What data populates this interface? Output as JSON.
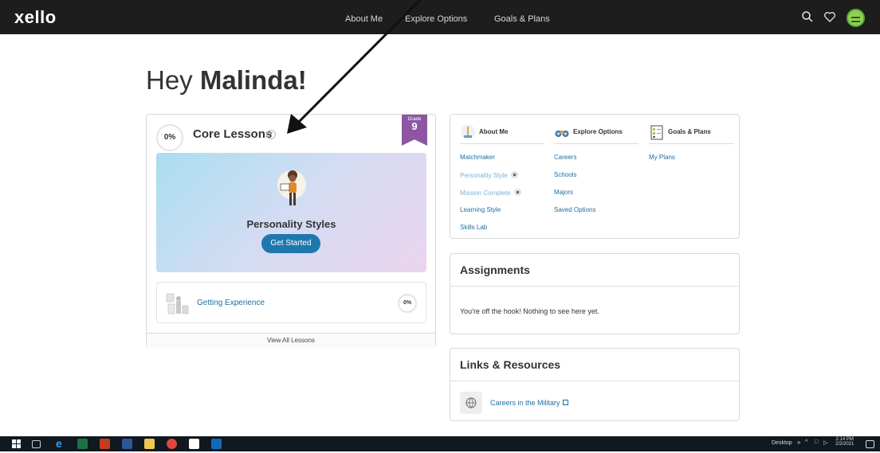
{
  "nav": {
    "logo": "xello",
    "items": [
      "About Me",
      "Explore Options",
      "Goals & Plans"
    ]
  },
  "greeting": {
    "hey": "Hey",
    "name": "Malinda!"
  },
  "core_lessons": {
    "progress": "0%",
    "title": "Core Lessons",
    "grade_label": "Grade",
    "grade": "9",
    "hero_title": "Personality Styles",
    "cta": "Get Started",
    "lessons": [
      {
        "name": "Getting Experience",
        "progress": "0%"
      }
    ],
    "view_all": "View All Lessons"
  },
  "explore": {
    "columns": [
      {
        "title": "About Me",
        "links": [
          {
            "label": "Matchmaker",
            "locked": false
          },
          {
            "label": "Personality Style",
            "locked": true
          },
          {
            "label": "Mission Complete",
            "locked": true
          },
          {
            "label": "Learning Style",
            "locked": false
          },
          {
            "label": "Skills Lab",
            "locked": false
          }
        ]
      },
      {
        "title": "Explore Options",
        "links": [
          {
            "label": "Careers",
            "locked": false
          },
          {
            "label": "Schools",
            "locked": false
          },
          {
            "label": "Majors",
            "locked": false
          },
          {
            "label": "Saved Options",
            "locked": false
          }
        ]
      },
      {
        "title": "Goals & Plans",
        "links": [
          {
            "label": "My Plans",
            "locked": false
          }
        ]
      }
    ]
  },
  "assignments": {
    "title": "Assignments",
    "message": "You're off the hook! Nothing to see here yet."
  },
  "links_resources": {
    "title": "Links & Resources",
    "items": [
      "Careers in the Military"
    ]
  },
  "taskbar": {
    "desktop_label": "Desktop",
    "time": "2:14 PM",
    "date": "2/2/2021"
  },
  "colors": {
    "brand_blue": "#1e78ad",
    "link": "#1e6ea0",
    "grade_purple": "#8c56a3",
    "nav_bg": "#1d1d1d"
  }
}
